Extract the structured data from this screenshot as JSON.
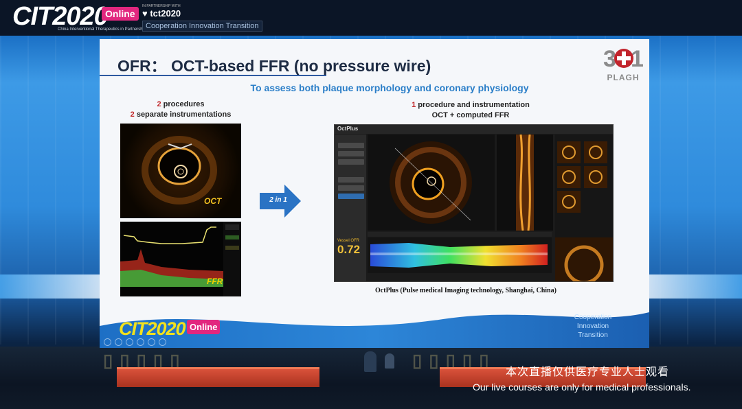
{
  "header": {
    "cit_logo": "CIT2020",
    "online_badge": "Online",
    "cit_tagline": "China Interventional Therapeutics in Partnership with TCT",
    "tct_partner": "IN PARTNERSHIP WITH",
    "tct_logo": "tct2020",
    "motto": "Cooperation Innovation Transition"
  },
  "slide": {
    "title": "OFR： OCT-based FFR (no pressure wire)",
    "subtitle": "To assess both plaque morphology and coronary physiology",
    "left": {
      "line1_num": "2",
      "line1_text": " procedures",
      "line2_num": "2",
      "line2_text": " separate instrumentations",
      "oct_label": "OCT",
      "ffr_label": "FFR"
    },
    "arrow_label": "2 in 1",
    "right": {
      "line1_num": "1",
      "line1_text": " procedure and instrumentation",
      "line2_text": "OCT + computed FFR"
    },
    "octplus": {
      "app_name": "OctPlus",
      "vessel_label": "Vessel OFR",
      "ffr_value": "0.72"
    },
    "caption": "OctPlus (Pulse medical Imaging technology, Shanghai, China)",
    "logo_label": "PLAGH",
    "footer": {
      "cit_logo": "CIT2020",
      "online_badge": "Online",
      "motto_1": "Cooperation",
      "motto_2": "Innovation",
      "motto_3": "Transition"
    }
  },
  "notice": {
    "zh": "本次直播仅供医疗专业人士观看",
    "en": "Our live courses are only for medical professionals."
  },
  "colors": {
    "title": "#1e2c44",
    "subtitle": "#2a7ec8",
    "number_red": "#c0282a",
    "arrow": "#2a73c4",
    "online_pink": "#e2277f",
    "footer_yellow": "#f2e11d"
  }
}
